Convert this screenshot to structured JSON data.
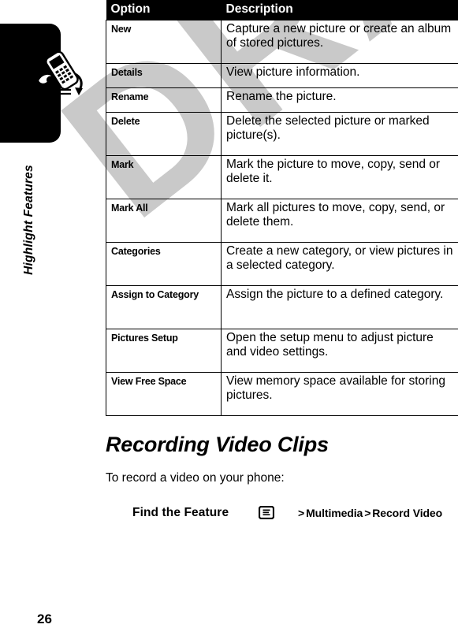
{
  "sidebar": {
    "chapter_label": "Highlight Features",
    "page_number": "26",
    "tab_icon": "phone-motion-icon"
  },
  "table": {
    "headers": [
      "Option",
      "Description"
    ],
    "rows": [
      {
        "option": "New",
        "description": "Capture a new picture or create an album of stored pictures."
      },
      {
        "option": "Details",
        "description": "View picture information."
      },
      {
        "option": "Rename",
        "description": "Rename the picture."
      },
      {
        "option": "Delete",
        "description": "Delete the selected picture or marked picture(s)."
      },
      {
        "option": "Mark",
        "description": "Mark the picture to move, copy, send or delete it."
      },
      {
        "option": "Mark All",
        "description": "Mark all pictures to move, copy, send, or delete them."
      },
      {
        "option": "Categories",
        "description": "Create a new category, or view pictures in a selected category."
      },
      {
        "option": "Assign to Category",
        "description": "Assign the picture to a defined category."
      },
      {
        "option": "Pictures Setup",
        "description": "Open the setup menu to adjust picture and video settings."
      },
      {
        "option": "View Free Space",
        "description": "View memory space available for storing pictures."
      }
    ]
  },
  "section": {
    "heading": "Recording Video Clips",
    "intro": "To record a video on your phone:",
    "find_feature": {
      "label": "Find the Feature",
      "icon": "menu-key-icon",
      "separator_1": ">",
      "item_1": "Multimedia",
      "separator_2": ">",
      "item_2": "Record Video",
      "path_full": "> Multimedia > Record Video"
    }
  },
  "watermark": {
    "text": "DRAFT",
    "color": "#c9c9c9"
  },
  "colors": {
    "header_bg": "#000000",
    "header_fg": "#ffffff",
    "rule": "#000000",
    "page_bg": "#ffffff"
  }
}
